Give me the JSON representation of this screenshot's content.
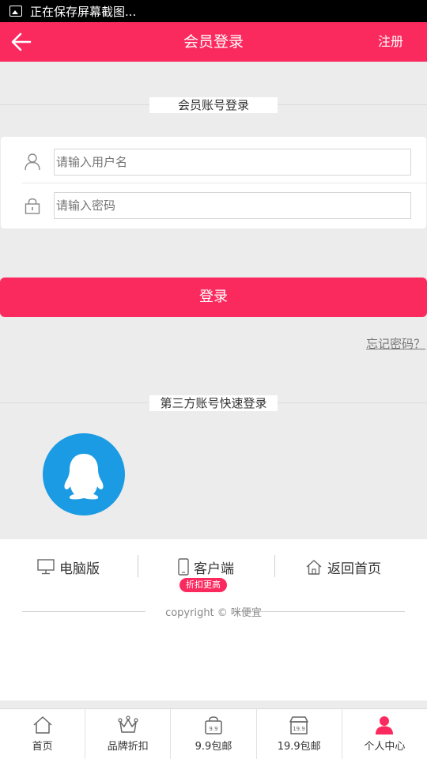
{
  "status_bar": {
    "text": "正在保存屏幕截图..."
  },
  "header": {
    "title": "会员登录",
    "register_label": "注册"
  },
  "account_section": {
    "label": "会员账号登录"
  },
  "form": {
    "username_placeholder": "请输入用户名",
    "password_placeholder": "请输入密码"
  },
  "login_button": {
    "label": "登录"
  },
  "forgot_link": {
    "label": "忘记密码？"
  },
  "third_party": {
    "label": "第三方账号快速登录",
    "providers": [
      {
        "name": "qq-icon"
      }
    ]
  },
  "footer": {
    "links": [
      {
        "label": "电脑版",
        "icon": "monitor-icon"
      },
      {
        "label": "客户端",
        "icon": "phone-icon"
      },
      {
        "label": "返回首页",
        "icon": "home-icon"
      }
    ],
    "client_badge": "折扣更高",
    "copyright": "copyright © 咪便宜"
  },
  "tabbar": {
    "items": [
      {
        "label": "首页",
        "icon": "home-icon"
      },
      {
        "label": "品牌折扣",
        "icon": "crown-icon"
      },
      {
        "label": "9.9包邮",
        "icon": "bag-icon"
      },
      {
        "label": "19.9包邮",
        "icon": "store-icon"
      },
      {
        "label": "个人中心",
        "icon": "user-icon",
        "active": true
      }
    ]
  },
  "colors": {
    "accent": "#fb2a5e",
    "qq_blue": "#1b9be3",
    "background": "#ececec"
  }
}
